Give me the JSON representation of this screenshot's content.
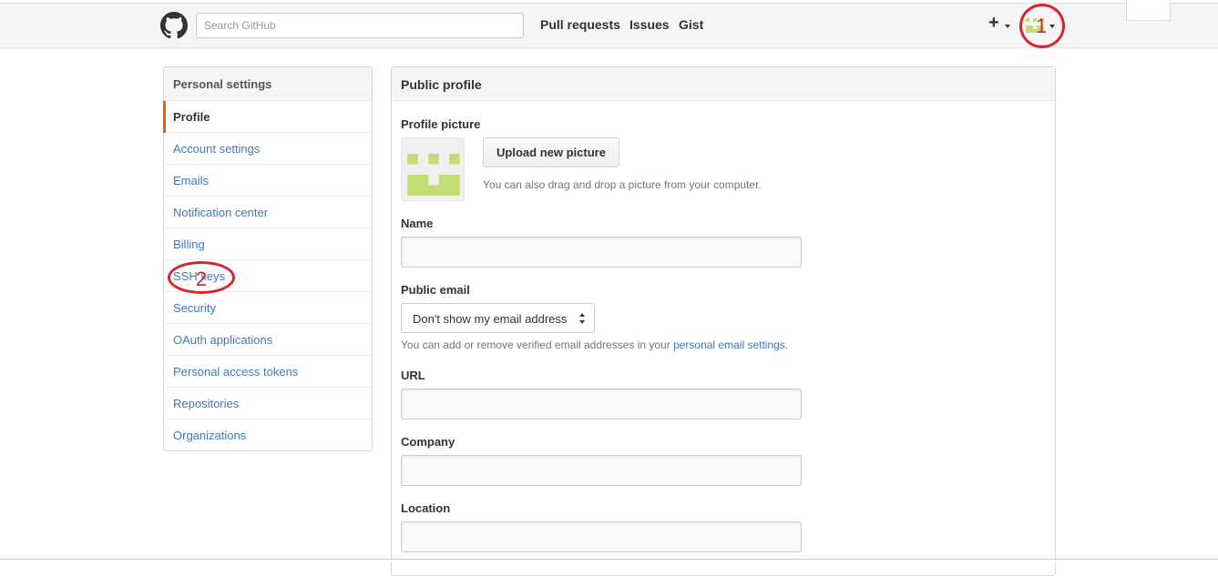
{
  "header": {
    "search_placeholder": "Search GitHub",
    "nav": [
      "Pull requests",
      "Issues",
      "Gist"
    ],
    "plus_label": "+"
  },
  "annotations": [
    "1",
    "2"
  ],
  "sidebar": {
    "title": "Personal settings",
    "items": [
      {
        "label": "Profile",
        "selected": true
      },
      {
        "label": "Account settings"
      },
      {
        "label": "Emails"
      },
      {
        "label": "Notification center"
      },
      {
        "label": "Billing"
      },
      {
        "label": "SSH keys"
      },
      {
        "label": "Security"
      },
      {
        "label": "OAuth applications"
      },
      {
        "label": "Personal access tokens"
      },
      {
        "label": "Repositories"
      },
      {
        "label": "Organizations"
      }
    ]
  },
  "main": {
    "title": "Public profile",
    "profile_picture_label": "Profile picture",
    "upload_button": "Upload new picture",
    "upload_hint": "You can also drag and drop a picture from your computer.",
    "name_label": "Name",
    "public_email_label": "Public email",
    "public_email_value": "Don't show my email address",
    "email_note_prefix": "You can add or remove verified email addresses in your ",
    "email_note_link": "personal email settings",
    "email_note_suffix": ".",
    "url_label": "URL",
    "company_label": "Company",
    "location_label": "Location"
  },
  "colors": {
    "accent_selected": "#d26911",
    "link": "#4078c0",
    "identicon": "#c5dd75",
    "annotation": "#d9232e"
  }
}
